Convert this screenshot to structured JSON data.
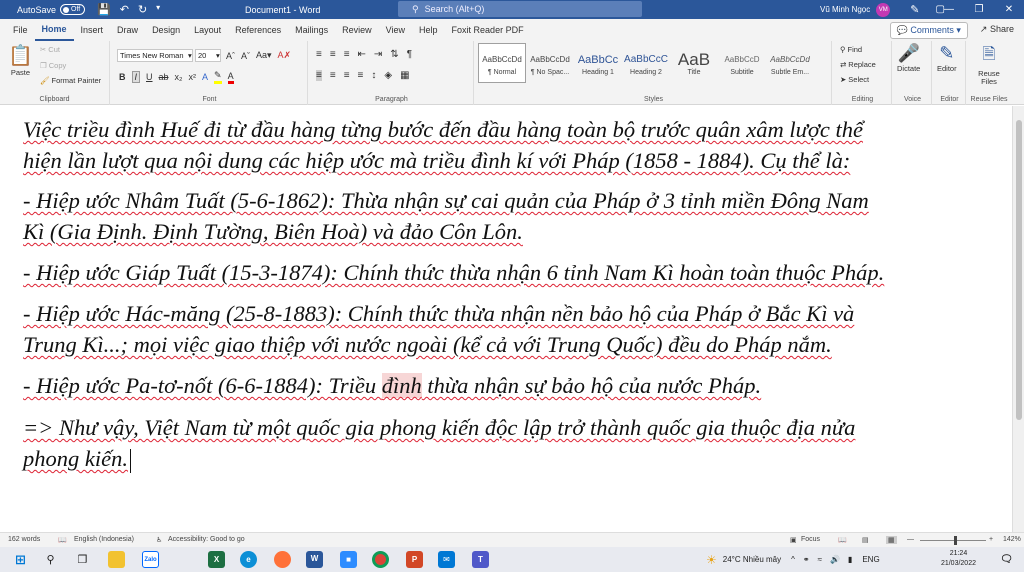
{
  "titlebar": {
    "autosave_label": "AutoSave",
    "autosave_state": "Off",
    "doc_title": "Document1 - Word",
    "search_placeholder": "Search (Alt+Q)",
    "user_name": "Vũ Minh Ngọc",
    "user_initials": "VM"
  },
  "tabs": [
    "File",
    "Home",
    "Insert",
    "Draw",
    "Design",
    "Layout",
    "References",
    "Mailings",
    "Review",
    "View",
    "Help",
    "Foxit Reader PDF"
  ],
  "tab_active": "Home",
  "tab_right": {
    "comments": "Comments",
    "share": "Share"
  },
  "ribbon": {
    "clipboard": {
      "paste": "Paste",
      "cut": "Cut",
      "copy": "Copy",
      "format_painter": "Format Painter",
      "label": "Clipboard"
    },
    "font": {
      "family": "Times New Roman",
      "size": "20",
      "label": "Font"
    },
    "paragraph": {
      "label": "Paragraph"
    },
    "styles": {
      "items": [
        {
          "preview": "AaBbCcDd",
          "name": "¶ Normal"
        },
        {
          "preview": "AaBbCcDd",
          "name": "¶ No Spac..."
        },
        {
          "preview": "AaBbCc",
          "name": "Heading 1"
        },
        {
          "preview": "AaBbCcC",
          "name": "Heading 2"
        },
        {
          "preview": "AaB",
          "name": "Title"
        },
        {
          "preview": "AaBbCcD",
          "name": "Subtitle"
        },
        {
          "preview": "AaBbCcDd",
          "name": "Subtle Em..."
        }
      ],
      "label": "Styles"
    },
    "editing": {
      "find": "Find",
      "replace": "Replace",
      "select": "Select",
      "label": "Editing"
    },
    "voice": {
      "dictate": "Dictate",
      "label": "Voice"
    },
    "editor": {
      "editor": "Editor",
      "label": "Editor"
    },
    "reuse": {
      "reuse": "Reuse Files",
      "label": "Reuse Files"
    }
  },
  "document": {
    "p1a": "Việc triều đình Huế đi từ đầu hàng từng bước đến đầu hàng toàn bộ trước quân xâm lược thể",
    "p1b": "hiện lần lượt qua nội dung các hiệp ước mà triều đình kí với Pháp (1858 - 1884). Cụ thể là:",
    "p2a": "- Hiệp ước Nhâm Tuất (5-6-1862): Thừa nhận sự cai quản của Pháp ở 3 tỉnh miền Đông Nam",
    "p2b": "Kì (Gia Định. Định Tường, Biên Hoà) và đảo Côn Lôn.",
    "p3": "- Hiệp ước Giáp Tuất (15-3-1874): Chính thức thừa nhận 6 tỉnh Nam Kì hoàn toàn thuộc Pháp.",
    "p4a": "- Hiệp ước Hác-măng (25-8-1883): Chính thức thừa nhận nền bảo hộ của Pháp ở Bắc Kì và",
    "p4b": "Trung Kì...; mọi việc giao thiệp với nước ngoài (kể cả với Trung Quốc) đều do Pháp nắm.",
    "p5_pre": "- Hiệp ước Pa-tơ-nốt (6-6-1884): Triều ",
    "p5_hl": "đình",
    "p5_post": " thừa nhận sự bảo hộ của nước Pháp.",
    "p6a": "=> Như vậy, Việt Nam từ một quốc gia phong kiến độc lập trở thành quốc gia thuộc địa nửa",
    "p6b": "phong kiến."
  },
  "statusbar": {
    "words": "162 words",
    "language": "English (Indonesia)",
    "accessibility": "Accessibility: Good to go",
    "focus": "Focus",
    "zoom": "142%"
  },
  "taskbar": {
    "weather": "24°C  Nhiều mây",
    "lang": "ENG",
    "time": "21:24",
    "date": "21/03/2022"
  }
}
